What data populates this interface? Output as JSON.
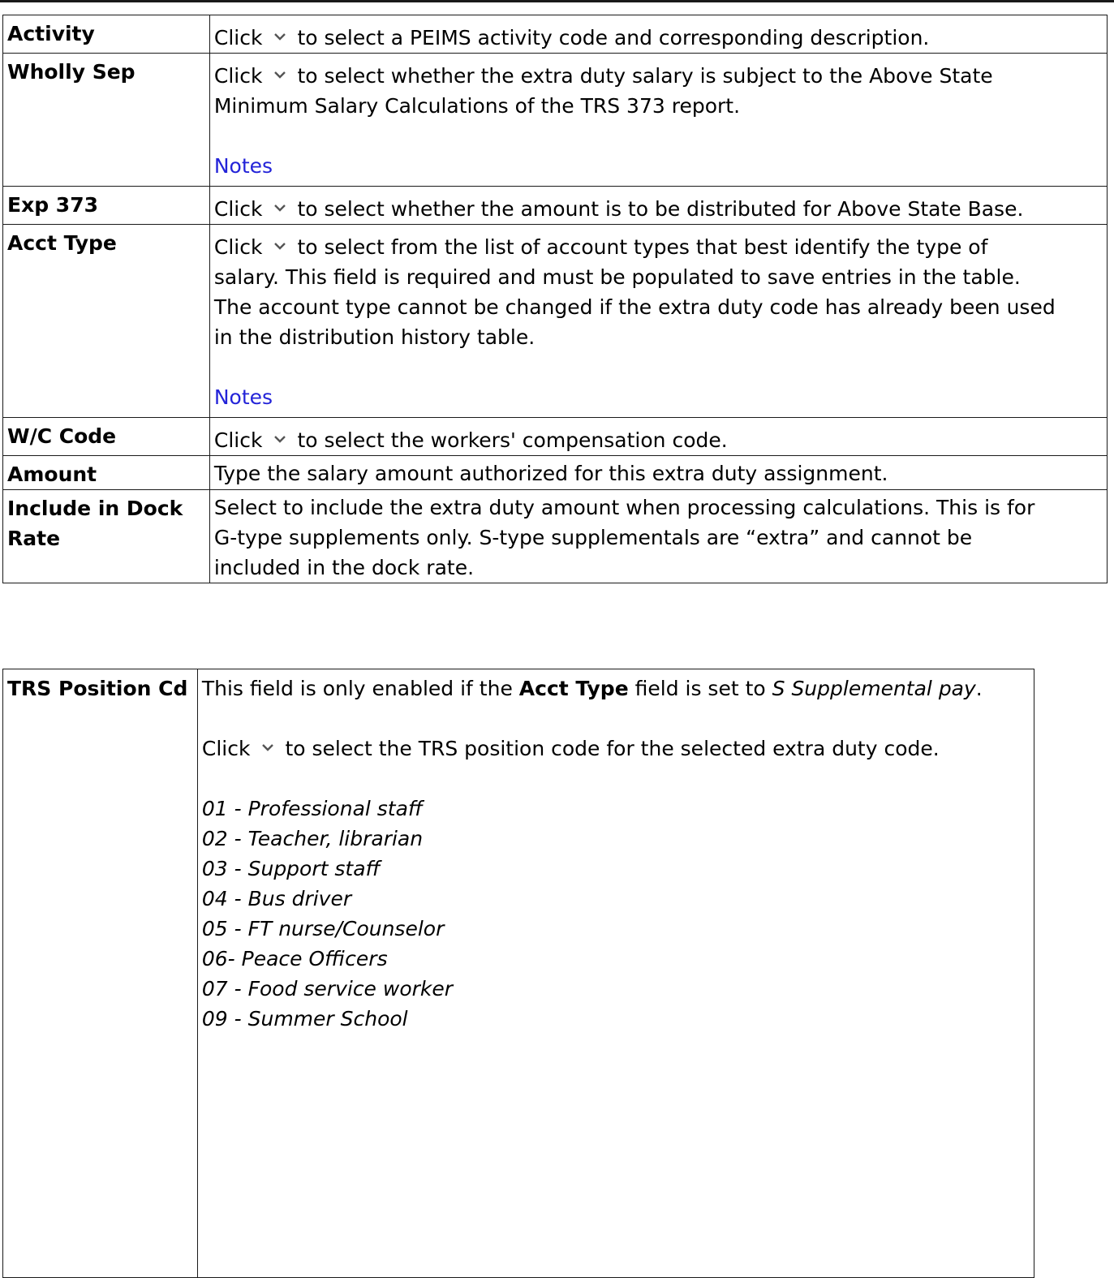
{
  "rows": [
    {
      "label": "Activity",
      "pre": "Click",
      "post": "to select a PEIMS activity code and corresponding description."
    },
    {
      "label": "Wholly Sep",
      "pre": "Click",
      "post": "to select whether the extra duty salary is subject to the Above State",
      "cont": "Minimum Salary Calculations of the TRS 373 report.",
      "link": "Notes"
    },
    {
      "label": "Exp 373",
      "pre": "Click",
      "post": "to select whether the amount is to be distributed for Above State Base."
    },
    {
      "label": "Acct Type",
      "pre": "Click",
      "post": "to select from the list of account types that best identify the type of",
      "lines": [
        "salary. This field is required and must be populated to save entries in the table.",
        "The account type cannot be changed if the extra duty code has already been used",
        "in the distribution history table."
      ],
      "link": "Notes"
    },
    {
      "label": "W/C Code",
      "pre": "Click",
      "post": "to select the workers' compensation code."
    },
    {
      "label": "Amount",
      "text": "Type the salary amount authorized for this extra duty assignment."
    },
    {
      "label_line1": "Include in Dock",
      "label_line2": "Rate",
      "lines": [
        "Select to include the extra duty amount when processing calculations. This is for",
        "G-type supplements only. S-type supplementals are “extra” and cannot be",
        "included in the dock rate."
      ]
    }
  ],
  "trs": {
    "label": "TRS Position Cd",
    "intro_pre": "This field is only enabled if the ",
    "intro_bold": "Acct Type",
    "intro_mid": " field is set to ",
    "intro_ital": "S Supplemental pay",
    "intro_end": ".",
    "click_pre": "Click",
    "click_post": "to select the TRS position code for the selected extra duty code.",
    "codes": [
      "01 - Professional staff",
      "02 - Teacher, librarian",
      "03 - Support staff",
      "04 - Bus driver",
      "05 - FT nurse/Counselor",
      "06- Peace Officers",
      "07 - Food service worker",
      "09 - Summer School"
    ]
  },
  "icons": {
    "dropdown": "chevron-down-icon"
  },
  "colors": {
    "link": "#2323d8",
    "chevron": "#555555",
    "border": "#1a1a1a"
  }
}
